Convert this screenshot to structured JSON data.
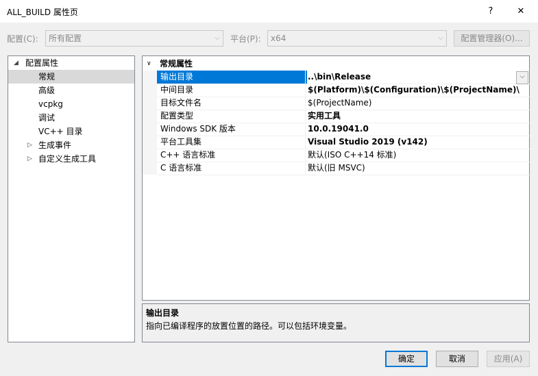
{
  "window": {
    "title": "ALL_BUILD 属性页",
    "help_label": "?",
    "close_label": "✕"
  },
  "config": {
    "config_label": "配置(C):",
    "config_value": "所有配置",
    "platform_label": "平台(P):",
    "platform_value": "x64",
    "manager_button": "配置管理器(O)..."
  },
  "tree": {
    "root": "配置属性",
    "items": [
      {
        "label": "常规",
        "selected": true
      },
      {
        "label": "高级"
      },
      {
        "label": "vcpkg"
      },
      {
        "label": "调试"
      },
      {
        "label": "VC++ 目录"
      },
      {
        "label": "生成事件",
        "expandable": true
      },
      {
        "label": "自定义生成工具",
        "expandable": true
      }
    ]
  },
  "grid": {
    "section": "常规属性",
    "rows": [
      {
        "name": "输出目录",
        "value": "..\\bin\\Release",
        "bold": true,
        "selected": true
      },
      {
        "name": "中间目录",
        "value": "$(Platform)\\$(Configuration)\\$(ProjectName)\\",
        "bold": true
      },
      {
        "name": "目标文件名",
        "value": "$(ProjectName)",
        "bold": false
      },
      {
        "name": "配置类型",
        "value": "实用工具",
        "bold": true
      },
      {
        "name": "Windows SDK 版本",
        "value": "10.0.19041.0",
        "bold": true
      },
      {
        "name": "平台工具集",
        "value": "Visual Studio 2019 (v142)",
        "bold": true
      },
      {
        "name": "C++ 语言标准",
        "value": "默认(ISO C++14 标准)",
        "bold": false
      },
      {
        "name": "C 语言标准",
        "value": "默认(旧 MSVC)",
        "bold": false
      }
    ]
  },
  "description": {
    "title": "输出目录",
    "text": "指向已编译程序的放置位置的路径。可以包括环境变量。"
  },
  "buttons": {
    "ok": "确定",
    "cancel": "取消",
    "apply": "应用(A)"
  },
  "colors": {
    "accent": "#0078d7",
    "tree_selection": "#d9d9d9"
  }
}
